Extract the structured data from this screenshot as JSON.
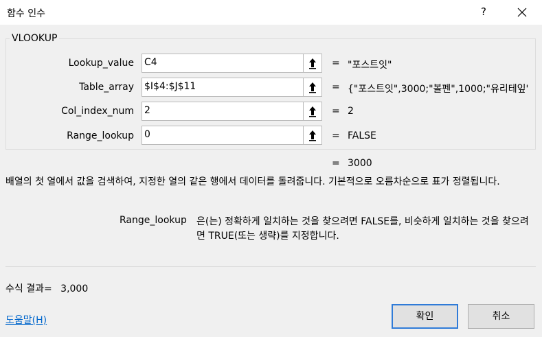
{
  "window": {
    "title": "함수 인수",
    "help_glyph": "?",
    "close_icon": "close-icon"
  },
  "function_name": "VLOOKUP",
  "arguments": [
    {
      "label": "Lookup_value",
      "input": "C4",
      "equals": "=",
      "value": "\"포스트잇\""
    },
    {
      "label": "Table_array",
      "input": "$I$4:$J$11",
      "equals": "=",
      "value": "{\"포스트잇\",3000;\"볼펜\",1000;\"유리테잎'"
    },
    {
      "label": "Col_index_num",
      "input": "2",
      "equals": "=",
      "value": "2"
    },
    {
      "label": "Range_lookup",
      "input": "0",
      "equals": "=",
      "value": "FALSE"
    }
  ],
  "result": {
    "equals": "=",
    "value": "3000"
  },
  "description": "배열의 첫 열에서 값을 검색하여, 지정한 열의 같은 행에서 데이터를 돌려줍니다. 기본적으로 오름차순으로 표가 정렬됩니다.",
  "arg_help": {
    "name": "Range_lookup",
    "text": "은(는) 정확하게 일치하는 것을 찾으려면 FALSE를, 비슷하게 일치하는 것을 찾으려면 TRUE(또는 생략)를 지정합니다."
  },
  "formula_result": {
    "label": "수식 결과=",
    "value": "3,000"
  },
  "help_link": "도움말(H)",
  "buttons": {
    "ok": "확인",
    "cancel": "취소"
  },
  "colors": {
    "background": "#f0f0f0",
    "link": "#0066cc",
    "ok_border": "#2f7bd8"
  }
}
